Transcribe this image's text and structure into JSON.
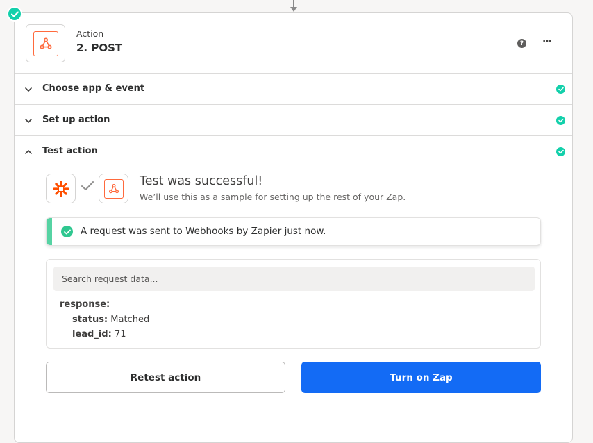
{
  "step": {
    "kind_label": "Action",
    "title": "2. POST",
    "app_icon": "webhook-icon",
    "status": "complete"
  },
  "header_controls": {
    "help": "?",
    "more": "···"
  },
  "sections": [
    {
      "label": "Choose app & event",
      "expanded": false,
      "complete": true
    },
    {
      "label": "Set up action",
      "expanded": false,
      "complete": true
    },
    {
      "label": "Test action",
      "expanded": true,
      "complete": true
    }
  ],
  "test": {
    "title": "Test was successful!",
    "subtitle": "We’ll use this as a sample for setting up the rest of your Zap.",
    "notice": "A request was sent to Webhooks by Zapier just now.",
    "search_placeholder": "Search request data...",
    "response": {
      "root_key": "response:",
      "fields": [
        {
          "key": "status:",
          "value": "Matched"
        },
        {
          "key": "lead_id:",
          "value": "71"
        }
      ]
    },
    "buttons": {
      "retest": "Retest action",
      "turn_on": "Turn on Zap"
    }
  },
  "colors": {
    "success": "#13d0ab",
    "primary": "#136bf5",
    "brand_orange": "#ff4f00",
    "webhook_orange": "#ff6a3d"
  }
}
